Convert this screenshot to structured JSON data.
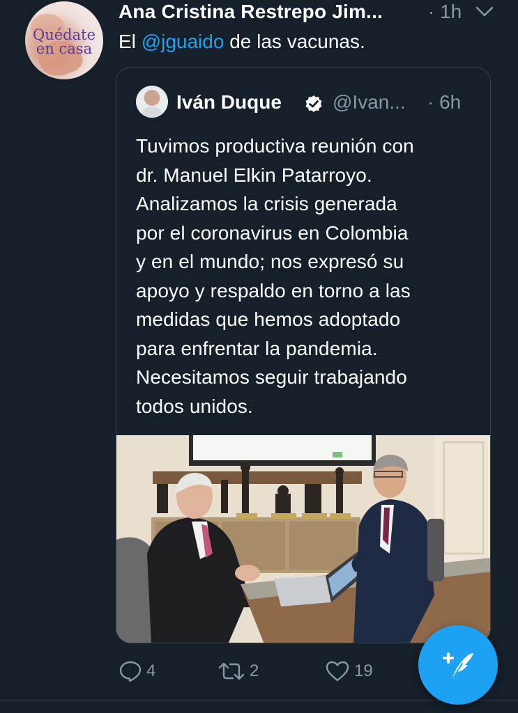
{
  "tweet": {
    "author_name": "Ana Cristina Restrepo Jim...",
    "time": "· 1h",
    "avatar_text_line1": "Quédate",
    "avatar_text_line2": "en casa",
    "text_prefix": "El ",
    "mention": "@jguaido",
    "text_suffix": " de las vacunas."
  },
  "quoted_tweet": {
    "author_name": "Iván Duque",
    "handle": "@Ivan...",
    "time": "· 6h",
    "body_lines": [
      "Tuvimos productiva reunión con",
      "dr. Manuel Elkin Patarroyo.",
      "Analizamos la crisis generada",
      "por el coronavirus en Colombia",
      "y en el mundo; nos expresó su",
      "apoyo y respaldo en torno a las",
      "medidas que hemos adoptado",
      "para enfrentar la pandemia.",
      "Necesitamos seguir trabajando",
      "todos unidos."
    ]
  },
  "actions": {
    "reply_count": "4",
    "retweet_count": "2",
    "like_count": "19"
  },
  "icons": {
    "reply": "reply-icon",
    "retweet": "retweet-icon",
    "like": "heart-icon",
    "more": "chevron-down-icon",
    "verified": "verified-badge-icon",
    "compose": "compose-tweet-icon"
  },
  "colors": {
    "background": "#15202b",
    "accent": "#1da1f2",
    "secondary_text": "#8899a6",
    "border": "#38444d"
  }
}
